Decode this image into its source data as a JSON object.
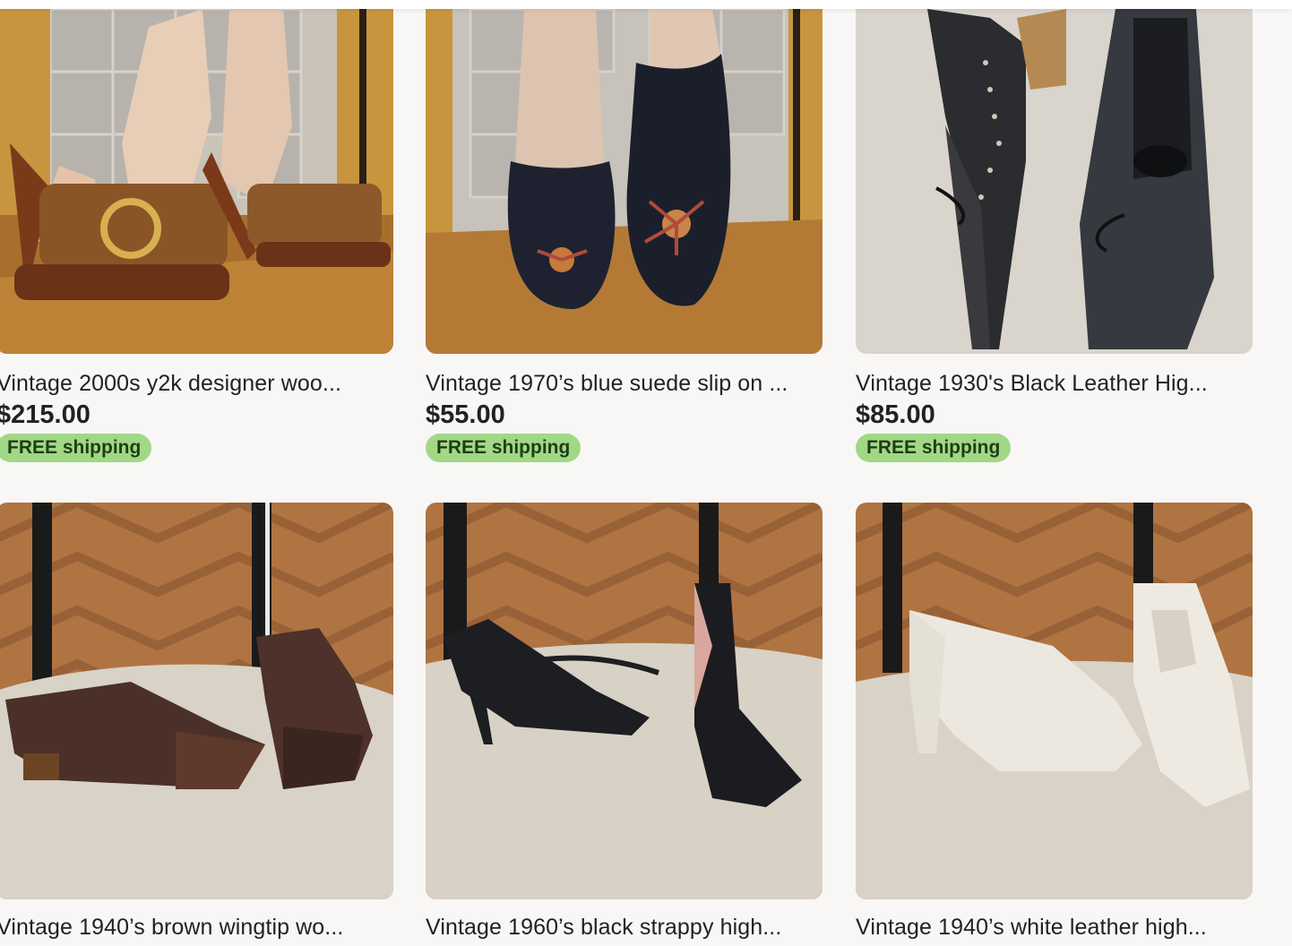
{
  "listings": [
    {
      "title": "Vintage 2000s y2k designer woo...",
      "price": "$215.00",
      "shipping": "FREE shipping",
      "image_desc_icon": "wood-platform-heel-mules-photo"
    },
    {
      "title": "Vintage 1970’s blue suede slip on ...",
      "price": "$55.00",
      "shipping": "FREE shipping",
      "image_desc_icon": "blue-suede-flats-photo"
    },
    {
      "title": "Vintage 1930's Black Leather Hig...",
      "price": "$85.00",
      "shipping": "FREE shipping",
      "image_desc_icon": "black-leather-heels-photo"
    },
    {
      "title": "Vintage 1940’s brown wingtip wo...",
      "image_desc_icon": "brown-wingtip-oxfords-photo"
    },
    {
      "title": "Vintage 1960’s black strappy high...",
      "image_desc_icon": "black-strappy-heels-photo"
    },
    {
      "title": "Vintage 1940’s white leather high...",
      "image_desc_icon": "white-leather-heels-photo"
    }
  ],
  "colors": {
    "badge_bg": "#a1d886",
    "badge_text": "#1f3d14",
    "page_bg": "#f8f7f5"
  }
}
